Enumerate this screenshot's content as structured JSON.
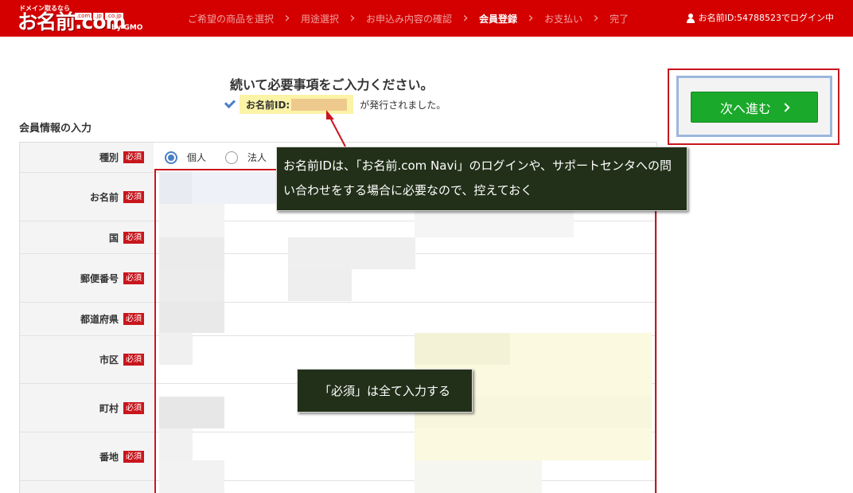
{
  "header": {
    "logo": {
      "tagline": "ドメイン取るなら",
      "name": "お名前.com",
      "tlds": [
        ".com",
        ".jp",
        ".co.jp"
      ],
      "by": "by GMO"
    },
    "steps": [
      {
        "label": "ご希望の商品を選択",
        "active": false
      },
      {
        "label": "用途選択",
        "active": false
      },
      {
        "label": "お申込み内容の確認",
        "active": false
      },
      {
        "label": "会員登録",
        "active": true
      },
      {
        "label": "お支払い",
        "active": false
      },
      {
        "label": "完了",
        "active": false
      }
    ],
    "step_separator": "›",
    "login_status": "お名前ID:54788523でログイン中"
  },
  "main": {
    "title": "続いて必要事項をご入力ください。",
    "notice": {
      "id_label": "お名前ID:",
      "issued_text": "が発行されました。"
    },
    "section_title": "会員情報の入力",
    "required_badge": "必須",
    "type_options": [
      {
        "label": "個人",
        "selected": true
      },
      {
        "label": "法人",
        "selected": false
      }
    ],
    "fields": [
      {
        "label": "種別"
      },
      {
        "label": "お名前"
      },
      {
        "label": "国"
      },
      {
        "label": "郵便番号"
      },
      {
        "label": "都道府県"
      },
      {
        "label": "市区"
      },
      {
        "label": "町村"
      },
      {
        "label": "番地"
      }
    ]
  },
  "next_button": {
    "label": "次へ進む"
  },
  "annotations": {
    "callout_id": "お名前IDは、「お名前.com Navi」のログインや、サポートセンタへの問い合わせをする場合に必要なので、控えておく",
    "callout_required": "「必須」は全て入力する"
  },
  "colors": {
    "header_bg": "#d40000",
    "required_badge": "#c8161d",
    "next_button": "#1aa92b",
    "callout_bg": "#223019",
    "annotation_frame": "#c8161d",
    "radio_selected": "#4a7fc6"
  }
}
